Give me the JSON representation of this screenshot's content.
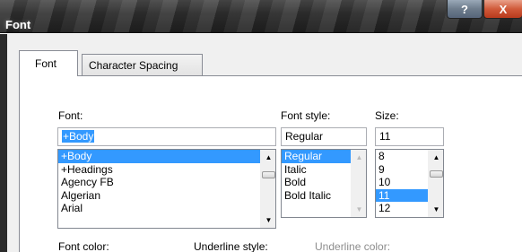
{
  "window": {
    "title": "Font",
    "help_label": "?",
    "close_label": "X"
  },
  "tabs": [
    {
      "label": "Font",
      "active": true
    },
    {
      "label": "Character Spacing",
      "active": false
    }
  ],
  "font": {
    "label": "Font:",
    "value": "+Body",
    "items": [
      "+Body",
      "+Headings",
      "Agency FB",
      "Algerian",
      "Arial"
    ],
    "selected_index": 0
  },
  "font_style": {
    "label": "Font style:",
    "value": "Regular",
    "items": [
      "Regular",
      "Italic",
      "Bold",
      "Bold Italic"
    ],
    "selected_index": 0
  },
  "size": {
    "label": "Size:",
    "value": "11",
    "items": [
      "8",
      "9",
      "10",
      "11",
      "12"
    ],
    "selected_index": 3
  },
  "bottom_labels": {
    "font_color": "Font color:",
    "underline_style": "Underline style:",
    "underline_color": "Underline color:"
  },
  "colors": {
    "selection": "#3399ff",
    "dialog_bg": "#f0f0f0",
    "titlebar": "#2f2f2f",
    "close_button": "#c9472a"
  },
  "icons": {
    "scroll_up": "triangle-up",
    "scroll_down": "triangle-down"
  }
}
